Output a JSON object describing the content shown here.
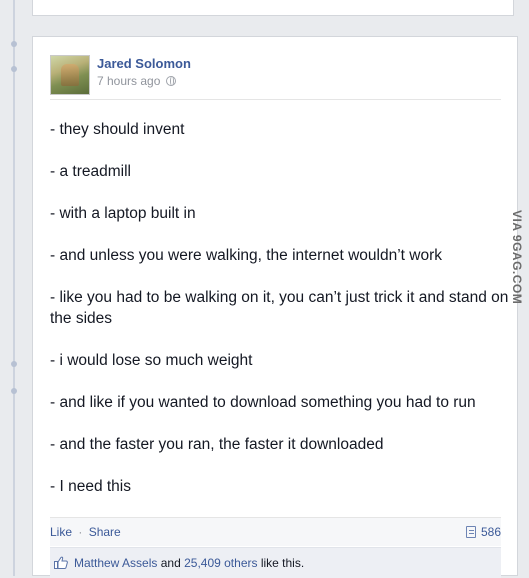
{
  "post": {
    "author": "Jared Solomon",
    "timestamp": "7 hours ago",
    "lines": [
      "- they should invent",
      "- a treadmill",
      "- with a laptop built in",
      "- and unless you were walking, the internet wouldn’t work",
      "- like you had to be walking on it, you can’t just trick it and stand on the sides",
      "- i would lose so much weight",
      "- and like if you wanted to download something you had to run",
      "- and the faster you ran, the faster it downloaded",
      "- I need this"
    ]
  },
  "actions": {
    "like": "Like",
    "separator": "·",
    "share": "Share",
    "comment_count": "586",
    "comment_icon": "comment-icon"
  },
  "likes": {
    "icon": "thumbs-up-icon",
    "user": "Matthew Assels",
    "and": "and",
    "others": "25,409 others",
    "suffix": "like this."
  },
  "watermark": "VIA 9GAG.COM",
  "colors": {
    "link": "#3b5998",
    "background": "#e9ebee",
    "text": "#141823",
    "muted": "#90949c"
  }
}
